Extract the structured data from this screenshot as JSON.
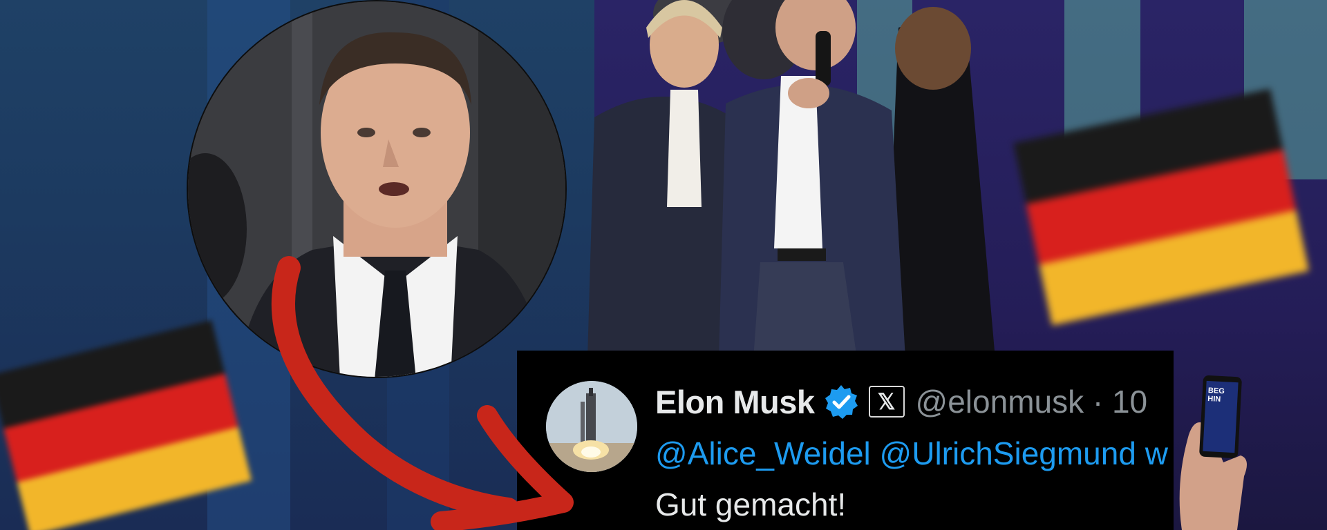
{
  "tweet": {
    "display_name": "Elon Musk",
    "handle_time": "@elonmusk · 10",
    "affiliate_badge": "𝕏",
    "mentions": "@Alice_Weidel @UlrichSiegmund w",
    "text": "Gut gemacht!",
    "verified_icon": "verified-badge-icon"
  },
  "colors": {
    "tweet_background": "#000000",
    "link_blue": "#1d9bf0",
    "name_text": "#e7e9ea",
    "handle_gray": "#8b9297",
    "arrow_red": "#c8261a",
    "flag_black": "#1a1a1a",
    "flag_red": "#d8201d",
    "flag_gold": "#f2b62a"
  },
  "phone_screen_text": "BEG HIN"
}
